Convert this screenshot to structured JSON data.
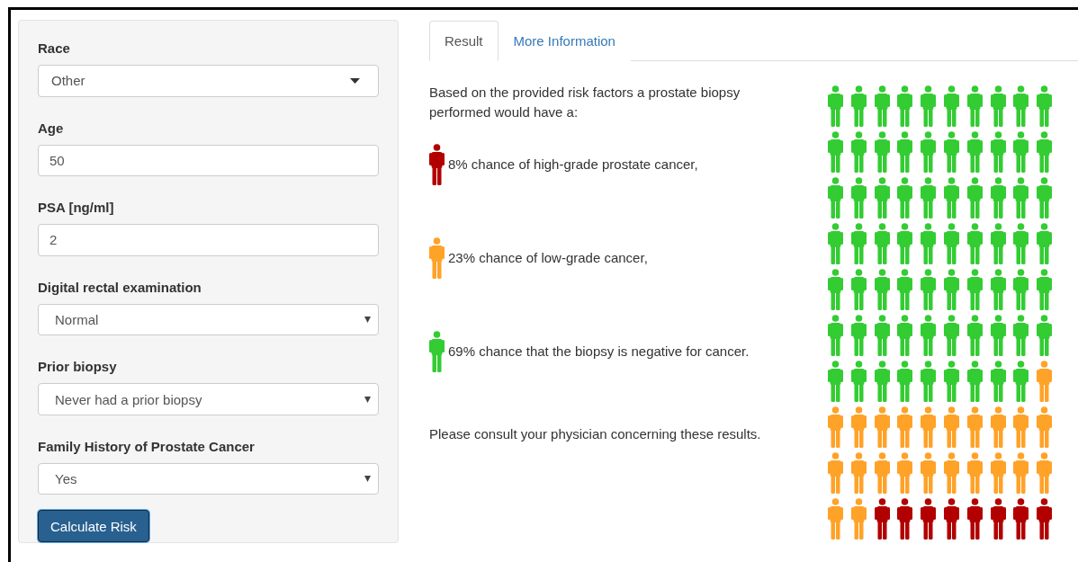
{
  "form": {
    "fields": [
      {
        "label": "Race",
        "kind": "picker",
        "value": "Other"
      },
      {
        "label": "Age",
        "kind": "input",
        "value": "50"
      },
      {
        "label": "PSA [ng/ml]",
        "kind": "input",
        "value": "2"
      },
      {
        "label": "Digital rectal examination",
        "kind": "select",
        "value": "Normal"
      },
      {
        "label": "Prior biopsy",
        "kind": "select",
        "value": "Never had a prior biopsy"
      },
      {
        "label": "Family History of Prostate Cancer",
        "kind": "select",
        "value": "Yes"
      }
    ],
    "button": "Calculate Risk"
  },
  "tabs": [
    {
      "label": "Result",
      "selected": true
    },
    {
      "label": "More Information",
      "selected": false
    }
  ],
  "result": {
    "intro": "Based on the provided risk factors a prostate biopsy performed would have a:",
    "outcomes": [
      {
        "text": "8% chance of high-grade prostate cancer,",
        "color": "#b20000"
      },
      {
        "text": "23% chance of low-grade cancer,",
        "color": "#ffa228"
      },
      {
        "text": "69% chance that the biopsy is negative for cancer.",
        "color": "#33cc33"
      }
    ],
    "note": "Please consult your physician concerning these results.",
    "pictogram": [
      {
        "color": "#33cc33"
      },
      {
        "color": "#33cc33"
      },
      {
        "color": "#33cc33"
      },
      {
        "color": "#33cc33"
      },
      {
        "color": "#33cc33"
      },
      {
        "color": "#33cc33"
      },
      {
        "color": "#33cc33"
      },
      {
        "color": "#33cc33"
      },
      {
        "color": "#33cc33"
      },
      {
        "color": "#33cc33"
      },
      {
        "color": "#33cc33"
      },
      {
        "color": "#33cc33"
      },
      {
        "color": "#33cc33"
      },
      {
        "color": "#33cc33"
      },
      {
        "color": "#33cc33"
      },
      {
        "color": "#33cc33"
      },
      {
        "color": "#33cc33"
      },
      {
        "color": "#33cc33"
      },
      {
        "color": "#33cc33"
      },
      {
        "color": "#33cc33"
      },
      {
        "color": "#33cc33"
      },
      {
        "color": "#33cc33"
      },
      {
        "color": "#33cc33"
      },
      {
        "color": "#33cc33"
      },
      {
        "color": "#33cc33"
      },
      {
        "color": "#33cc33"
      },
      {
        "color": "#33cc33"
      },
      {
        "color": "#33cc33"
      },
      {
        "color": "#33cc33"
      },
      {
        "color": "#33cc33"
      },
      {
        "color": "#33cc33"
      },
      {
        "color": "#33cc33"
      },
      {
        "color": "#33cc33"
      },
      {
        "color": "#33cc33"
      },
      {
        "color": "#33cc33"
      },
      {
        "color": "#33cc33"
      },
      {
        "color": "#33cc33"
      },
      {
        "color": "#33cc33"
      },
      {
        "color": "#33cc33"
      },
      {
        "color": "#33cc33"
      },
      {
        "color": "#33cc33"
      },
      {
        "color": "#33cc33"
      },
      {
        "color": "#33cc33"
      },
      {
        "color": "#33cc33"
      },
      {
        "color": "#33cc33"
      },
      {
        "color": "#33cc33"
      },
      {
        "color": "#33cc33"
      },
      {
        "color": "#33cc33"
      },
      {
        "color": "#33cc33"
      },
      {
        "color": "#33cc33"
      },
      {
        "color": "#33cc33"
      },
      {
        "color": "#33cc33"
      },
      {
        "color": "#33cc33"
      },
      {
        "color": "#33cc33"
      },
      {
        "color": "#33cc33"
      },
      {
        "color": "#33cc33"
      },
      {
        "color": "#33cc33"
      },
      {
        "color": "#33cc33"
      },
      {
        "color": "#33cc33"
      },
      {
        "color": "#33cc33"
      },
      {
        "color": "#33cc33"
      },
      {
        "color": "#33cc33"
      },
      {
        "color": "#33cc33"
      },
      {
        "color": "#33cc33"
      },
      {
        "color": "#33cc33"
      },
      {
        "color": "#33cc33"
      },
      {
        "color": "#33cc33"
      },
      {
        "color": "#33cc33"
      },
      {
        "color": "#33cc33"
      },
      {
        "color": "#ffa228"
      },
      {
        "color": "#ffa228"
      },
      {
        "color": "#ffa228"
      },
      {
        "color": "#ffa228"
      },
      {
        "color": "#ffa228"
      },
      {
        "color": "#ffa228"
      },
      {
        "color": "#ffa228"
      },
      {
        "color": "#ffa228"
      },
      {
        "color": "#ffa228"
      },
      {
        "color": "#ffa228"
      },
      {
        "color": "#ffa228"
      },
      {
        "color": "#ffa228"
      },
      {
        "color": "#ffa228"
      },
      {
        "color": "#ffa228"
      },
      {
        "color": "#ffa228"
      },
      {
        "color": "#ffa228"
      },
      {
        "color": "#ffa228"
      },
      {
        "color": "#ffa228"
      },
      {
        "color": "#ffa228"
      },
      {
        "color": "#ffa228"
      },
      {
        "color": "#ffa228"
      },
      {
        "color": "#ffa228"
      },
      {
        "color": "#ffa228"
      },
      {
        "color": "#b20000"
      },
      {
        "color": "#b20000"
      },
      {
        "color": "#b20000"
      },
      {
        "color": "#b20000"
      },
      {
        "color": "#b20000"
      },
      {
        "color": "#b20000"
      },
      {
        "color": "#b20000"
      },
      {
        "color": "#b20000"
      }
    ]
  }
}
